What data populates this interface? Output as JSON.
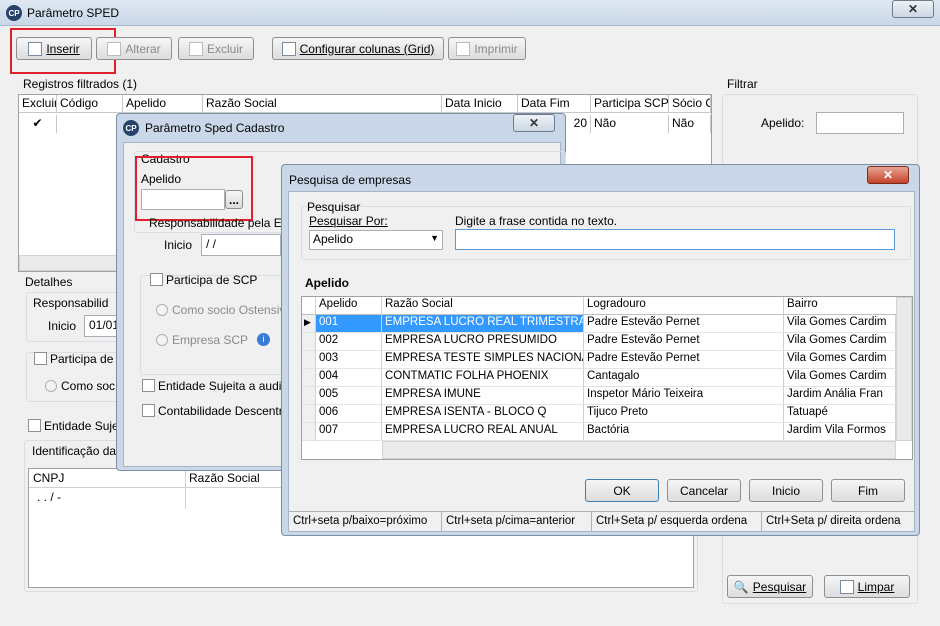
{
  "main_window": {
    "title": "Parâmetro SPED",
    "toolbar": {
      "inserir": "Inserir",
      "alterar": "Alterar",
      "excluir": "Excluir",
      "configurar": "Configurar colunas (Grid)",
      "imprimir": "Imprimir"
    },
    "registros_label": "Registros filtrados (1)",
    "grid": {
      "columns": [
        "Excluir",
        "Código",
        "Apelido",
        "Razão Social",
        "Data Inicio",
        "Data Fim",
        "Participa SCP",
        "Sócio O"
      ],
      "row": {
        "data_fim": "20",
        "participa_scp": "Não",
        "socio": "Não"
      }
    },
    "detalhes_label": "Detalhes",
    "responsabilidade_label": "Responsabilid",
    "inicio_label": "Inicio",
    "inicio_value": "01/01",
    "participa_label": "Participa de",
    "como_soc_label": "Como soc",
    "entidade_label": "Entidade Suje",
    "identificacao_label": "Identificação da",
    "cnpj_header": "CNPJ",
    "razao_header": "Razão Social",
    "cnpj_mask": ". . /  -",
    "filtrar": {
      "label": "Filtrar",
      "apelido_label": "Apelido:",
      "pesquisar_button": "Pesquisar",
      "limpar_button": "Limpar"
    }
  },
  "cadastro_dialog": {
    "title": "Parâmetro Sped Cadastro",
    "cadastro_label": "Cadastro",
    "apelido_label": "Apelido",
    "ellipsis": "...",
    "responsabilidade_label": "Responsabilidade pela En",
    "inicio_label": "Inicio",
    "inicio_value": " / /",
    "participa_scp_label": "Participa de SCP",
    "como_socio_label": "Como socio Ostensiv",
    "empresa_scp_label": "Empresa SCP",
    "entidade_label": "Entidade Sujeita a audit",
    "contabilidade_label": "Contabilidade Descentr"
  },
  "pesquisa_dialog": {
    "title": "Pesquisa de empresas",
    "pesquisar_group": "Pesquisar",
    "pesquisar_por_label": "Pesquisar Por:",
    "pesquisar_por_value": "Apelido",
    "digite_label": "Digite a frase contida no texto.",
    "sort_label": "Apelido",
    "columns": [
      "Apelido",
      "Razão Social",
      "Logradouro",
      "Bairro"
    ],
    "rows": [
      {
        "apelido": "001",
        "razao": "EMPRESA LUCRO REAL TRIMESTRAL",
        "logradouro": "Padre Estevão Pernet",
        "bairro": "Vila Gomes Cardim"
      },
      {
        "apelido": "002",
        "razao": "EMPRESA LUCRO PRESUMIDO",
        "logradouro": "Padre Estevão Pernet",
        "bairro": "Vila Gomes Cardim"
      },
      {
        "apelido": "003",
        "razao": "EMPRESA TESTE SIMPLES NACIONAL",
        "logradouro": "Padre Estevão Pernet",
        "bairro": "Vila Gomes Cardim"
      },
      {
        "apelido": "004",
        "razao": "CONTMATIC FOLHA PHOENIX",
        "logradouro": "Cantagalo",
        "bairro": "Vila Gomes Cardim"
      },
      {
        "apelido": "005",
        "razao": "EMPRESA IMUNE",
        "logradouro": "Inspetor Mário Teixeira",
        "bairro": "Jardim Anália Fran"
      },
      {
        "apelido": "006",
        "razao": "EMPRESA ISENTA - BLOCO Q",
        "logradouro": "Tijuco Preto",
        "bairro": "Tatuapé"
      },
      {
        "apelido": "007",
        "razao": "EMPRESA LUCRO REAL ANUAL",
        "logradouro": "Bactória",
        "bairro": "Jardim Vila Formos"
      }
    ],
    "buttons": {
      "ok": "OK",
      "cancelar": "Cancelar",
      "inicio": "Inicio",
      "fim": "Fim"
    },
    "status": [
      "Ctrl+seta p/baixo=próximo",
      "Ctrl+seta p/cima=anterior",
      "Ctrl+Seta p/ esquerda ordena",
      "Ctrl+Seta p/ direita ordena"
    ]
  },
  "colors": {
    "accent": "#3399ff",
    "highlight_red": "#e0202a",
    "title_blue": "#c9d7e8"
  }
}
